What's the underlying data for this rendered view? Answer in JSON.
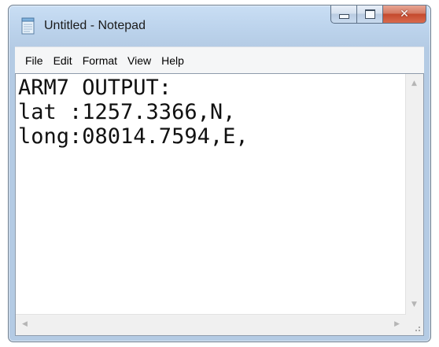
{
  "window": {
    "title": "Untitled - Notepad"
  },
  "icons": {
    "app": "notepad-icon",
    "minimize": "minimize-icon",
    "maximize": "maximize-icon",
    "close": "close-icon"
  },
  "menu": {
    "items": [
      "File",
      "Edit",
      "Format",
      "View",
      "Help"
    ]
  },
  "editor": {
    "lines": [
      "ARM7 OUTPUT:",
      "lat :1257.3366,N,",
      "long:08014.7594,E,"
    ]
  },
  "colors": {
    "frame": "#b4cbe4",
    "close_button": "#c44a2e"
  }
}
